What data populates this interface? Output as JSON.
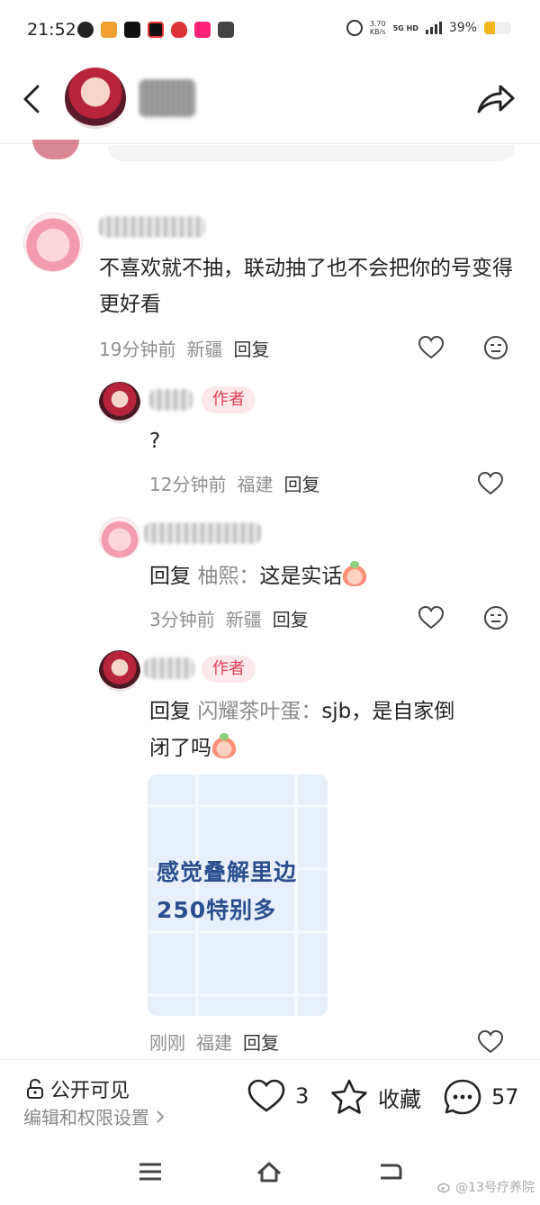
{
  "status_bar": {
    "time": "21:52",
    "net_speed": "3.70",
    "net_speed_unit": "KB/s",
    "network": "5G HD",
    "battery": "39%",
    "battery_level": 0.39,
    "battery_color": "#f3b51c"
  },
  "header": {
    "back_icon": "chevron-left-icon",
    "share_icon": "share-arrow-icon"
  },
  "comments": [
    {
      "text": "不喜欢就不抽，联动抽了也不会把你的号变得更好看",
      "time": "19分钟前",
      "location": "新疆",
      "reply_label": "回复"
    },
    {
      "author_tag": "作者",
      "text": "?",
      "time": "12分钟前",
      "location": "福建",
      "reply_label": "回复"
    },
    {
      "reply_prefix": "回复",
      "reply_target": "柚熙：",
      "text": "这是实话",
      "time": "3分钟前",
      "location": "新疆",
      "reply_label": "回复"
    },
    {
      "author_tag": "作者",
      "reply_prefix": "回复",
      "reply_target": "闪耀茶叶蛋：",
      "text_line1": "sjb，是自家倒",
      "text_line2": "闭了吗",
      "image_text_line1": "感觉叠解里边",
      "image_text_line2": "250特别多",
      "time": "刚刚",
      "location": "福建",
      "reply_label": "回复"
    }
  ],
  "bottom_bar": {
    "visibility": "公开可见",
    "permission_setting": "编辑和权限设置",
    "like_count": "3",
    "favorite_label": "收藏",
    "comment_count": "57"
  },
  "watermark": "@13号疗养院",
  "colors": {
    "author_tag_bg": "#fde9ec",
    "author_tag_text": "#e03e55",
    "image_text": "#2a4e8f"
  }
}
